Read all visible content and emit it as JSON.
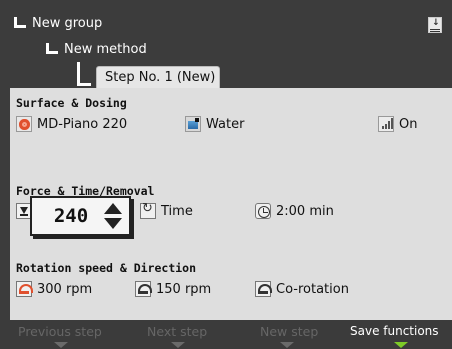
{
  "tree": {
    "group_label": "New group",
    "method_label": "New method",
    "step_tab_label": "Step No. 1 (New)"
  },
  "sections": {
    "surface": {
      "title": "Surface & Dosing",
      "disc": "MD-Piano 220",
      "lubricant": "Water",
      "dosing": "On"
    },
    "force": {
      "title": "Force & Time/Removal",
      "force_value": "240",
      "mode": "Time",
      "duration": "2:00 min"
    },
    "rotation": {
      "title": "Rotation speed & Direction",
      "disc_speed": "300 rpm",
      "holder_speed": "150 rpm",
      "direction": "Co-rotation"
    }
  },
  "footer": {
    "previous_step": "Previous step",
    "next_step": "Next step",
    "new_step": "New step",
    "save_functions": "Save functions"
  },
  "colors": {
    "background": "#3c3c3c",
    "panel": "#dedede",
    "tab": "#e6e6e6",
    "accent_green": "#7ecb28",
    "accent_red": "#e0502e",
    "disabled_text": "#666666"
  },
  "icons": {
    "corner": "download-icon",
    "disc": "disc-icon",
    "lubricant": "water-icon",
    "dosing": "signal-bars-icon",
    "force": "down-arrow-icon",
    "mode": "time-mode-icon",
    "duration": "clock-icon",
    "disc_speed": "disc-rotation-icon",
    "holder_speed": "holder-rotation-icon",
    "direction": "co-rotation-icon"
  }
}
